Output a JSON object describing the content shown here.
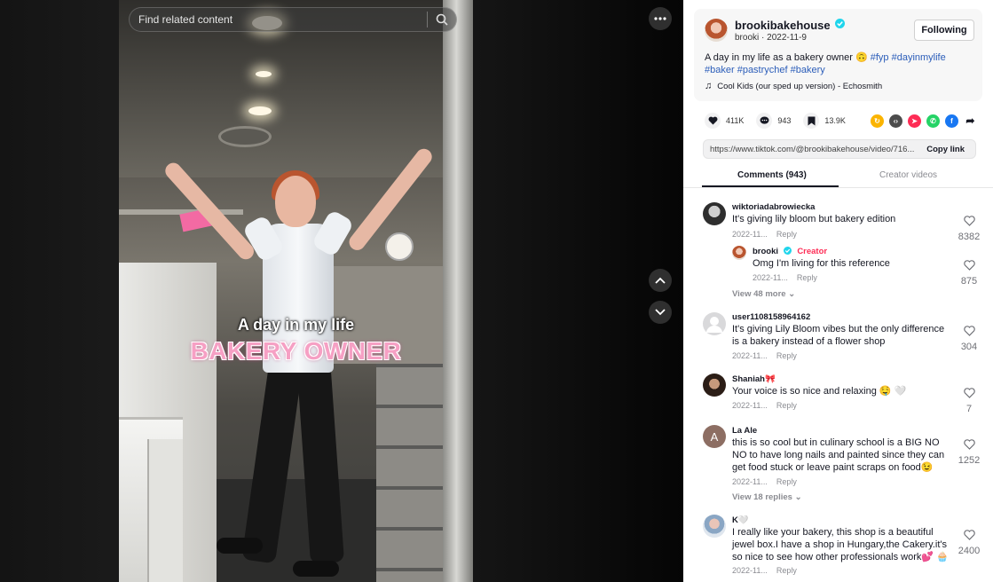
{
  "search": {
    "placeholder": "Find related content"
  },
  "caption": {
    "line1": "A day in my life",
    "line2": "BAKERY OWNER"
  },
  "author": {
    "handle": "brookibakehouse",
    "name": "brooki",
    "date": "2022-11-9",
    "follow_label": "Following"
  },
  "description": {
    "text": "A day in my life as a bakery owner 🙃",
    "tags": [
      "#fyp",
      "#dayinmylife",
      "#baker",
      "#pastrychef",
      "#bakery"
    ]
  },
  "music": "Cool Kids (our sped up version) - Echosmith",
  "stats": {
    "likes": "411K",
    "comments": "943",
    "saves": "13.9K"
  },
  "share_colors": [
    "#fbb400",
    "#4c4c4c",
    "#fe2c55",
    "#25d366",
    "#1877f2",
    "#161823"
  ],
  "share_icons": [
    "repost-icon",
    "embed-icon",
    "send-icon",
    "whatsapp-icon",
    "facebook-icon",
    "share-arrow-icon"
  ],
  "link": {
    "url": "https://www.tiktok.com/@brookibakehouse/video/716...",
    "copy_label": "Copy link"
  },
  "tabs": {
    "comments": "Comments (943)",
    "creator": "Creator videos"
  },
  "comments": [
    {
      "user": "wiktoriadabrowiecka",
      "text": "It's giving lily bloom but bakery edition",
      "date": "2022-11...",
      "reply": "Reply",
      "likes": "8382"
    },
    {
      "user": "brooki",
      "badge": "Creator",
      "text": "Omg I'm living for this reference",
      "date": "2022-11...",
      "reply": "Reply",
      "likes": "875"
    },
    {
      "user": "user1108158964162",
      "text": "It's giving Lily Bloom vibes but the only difference is a bakery instead of a flower shop",
      "date": "2022-11...",
      "reply": "Reply",
      "likes": "304"
    },
    {
      "user": "Shaniah🎀",
      "text": "Your voice is so nice and relaxing 🤤 🤍",
      "date": "2022-11...",
      "reply": "Reply",
      "likes": "7"
    },
    {
      "user": "La Ale",
      "avatar_letter": "A",
      "text": "this is so cool but in culinary school is a BIG NO NO to have long nails and painted since they can get food stuck or leave paint scraps on food😉",
      "date": "2022-11...",
      "reply": "Reply",
      "likes": "1252"
    },
    {
      "user": "K🤍",
      "text": "I really like your bakery, this shop is a beautiful jewel box.I have a shop in Hungary,the Cakery.it's so nice to see how other professionals work💕 🧁",
      "date": "2022-11...",
      "reply": "Reply",
      "likes": "2400"
    }
  ],
  "view_more": {
    "first": "View 48 more",
    "second": "View 18 replies"
  }
}
